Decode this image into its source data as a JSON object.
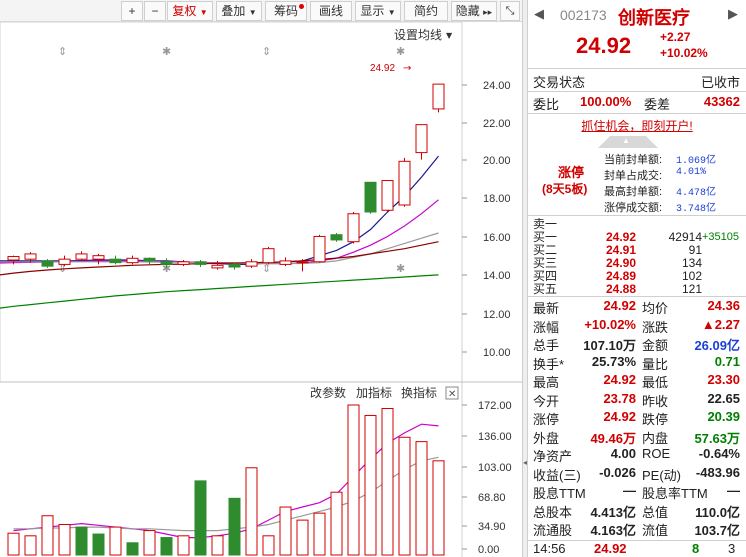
{
  "toolbar": {
    "plus": "+",
    "minus": "−",
    "fuquan": "复权",
    "diejia": "叠加",
    "chouma": "筹码",
    "huaxian": "画线",
    "xianshi": "显示",
    "jianyue": "简约",
    "yincang": "隐藏"
  },
  "chart": {
    "settings_label": "设置均线",
    "last_price_marker": "24.92",
    "price_ticks": [
      "24.00",
      "22.00",
      "20.00",
      "18.00",
      "16.00",
      "14.00",
      "12.00",
      "10.00"
    ],
    "indicator_buttons": {
      "change_params": "改参数",
      "add_indicator": "加指标",
      "switch_indicator": "换指标"
    },
    "volume_ticks": [
      "172.00",
      "136.00",
      "103.00",
      "68.80",
      "34.90",
      "0.00"
    ]
  },
  "chart_data": {
    "type": "candlestick",
    "y_range": [
      9.3,
      26.3
    ],
    "candles": [
      {
        "open": 14.85,
        "close": 15.05,
        "high": 15.1,
        "low": 14.6
      },
      {
        "open": 14.9,
        "close": 15.2,
        "high": 15.3,
        "low": 14.7
      },
      {
        "open": 14.8,
        "close": 14.5,
        "high": 14.9,
        "low": 14.4
      },
      {
        "open": 14.6,
        "close": 14.9,
        "high": 15.1,
        "low": 14.5
      },
      {
        "open": 14.9,
        "close": 15.2,
        "high": 15.35,
        "low": 14.8
      },
      {
        "open": 14.9,
        "close": 15.1,
        "high": 15.2,
        "low": 14.6
      },
      {
        "open": 14.9,
        "close": 14.7,
        "high": 15.1,
        "low": 14.6
      },
      {
        "open": 14.7,
        "close": 14.95,
        "high": 15.1,
        "low": 14.6
      },
      {
        "open": 14.95,
        "close": 14.8,
        "high": 15.0,
        "low": 14.6
      },
      {
        "open": 14.75,
        "close": 14.6,
        "high": 14.95,
        "low": 14.4
      },
      {
        "open": 14.6,
        "close": 14.75,
        "high": 14.85,
        "low": 14.5
      },
      {
        "open": 14.75,
        "close": 14.6,
        "high": 14.85,
        "low": 14.45
      },
      {
        "open": 14.4,
        "close": 14.55,
        "high": 14.8,
        "low": 14.3
      },
      {
        "open": 14.6,
        "close": 14.45,
        "high": 14.7,
        "low": 14.3
      },
      {
        "open": 14.5,
        "close": 14.75,
        "high": 14.9,
        "low": 14.4
      },
      {
        "open": 14.7,
        "close": 15.5,
        "high": 15.6,
        "low": 14.6
      },
      {
        "open": 14.6,
        "close": 14.8,
        "high": 15.0,
        "low": 14.5
      },
      {
        "open": 14.7,
        "close": 14.75,
        "high": 14.9,
        "low": 14.2
      },
      {
        "open": 14.75,
        "close": 16.2,
        "high": 16.3,
        "low": 14.7
      },
      {
        "open": 16.3,
        "close": 16.0,
        "high": 16.4,
        "low": 15.9
      },
      {
        "open": 15.9,
        "close": 17.5,
        "high": 17.6,
        "low": 15.8
      },
      {
        "open": 19.3,
        "close": 17.6,
        "high": 19.3,
        "low": 17.5
      },
      {
        "open": 17.7,
        "close": 19.4,
        "high": 19.4,
        "low": 17.6
      },
      {
        "open": 18.0,
        "close": 20.5,
        "high": 20.7,
        "low": 17.9
      },
      {
        "open": 21.0,
        "close": 22.6,
        "high": 22.6,
        "low": 20.6
      },
      {
        "open": 23.5,
        "close": 24.92,
        "high": 24.92,
        "low": 23.3
      }
    ],
    "volumes": [
      {
        "value": 25,
        "color": "red"
      },
      {
        "value": 22,
        "color": "red"
      },
      {
        "value": 45,
        "color": "red"
      },
      {
        "value": 35,
        "color": "red"
      },
      {
        "value": 32,
        "color": "green"
      },
      {
        "value": 24,
        "color": "green"
      },
      {
        "value": 32,
        "color": "red"
      },
      {
        "value": 14,
        "color": "green"
      },
      {
        "value": 28,
        "color": "red"
      },
      {
        "value": 20,
        "color": "green"
      },
      {
        "value": 22,
        "color": "red"
      },
      {
        "value": 85,
        "color": "green"
      },
      {
        "value": 22,
        "color": "red"
      },
      {
        "value": 65,
        "color": "green"
      },
      {
        "value": 100,
        "color": "red"
      },
      {
        "value": 22,
        "color": "red"
      },
      {
        "value": 55,
        "color": "red"
      },
      {
        "value": 40,
        "color": "red"
      },
      {
        "value": 48,
        "color": "red"
      },
      {
        "value": 72,
        "color": "red"
      },
      {
        "value": 172,
        "color": "red"
      },
      {
        "value": 160,
        "color": "red"
      },
      {
        "value": 168,
        "color": "red"
      },
      {
        "value": 135,
        "color": "red"
      },
      {
        "value": 130,
        "color": "red"
      },
      {
        "value": 108,
        "color": "red"
      }
    ],
    "ma_lines": [
      {
        "color": "#1a1a8c",
        "values": [
          14.8,
          14.8,
          14.8,
          14.8,
          14.82,
          14.85,
          14.85,
          14.85,
          14.8,
          14.8,
          14.75,
          14.7,
          14.65,
          14.6,
          14.6,
          14.7,
          14.75,
          14.8,
          15.1,
          15.4,
          15.9,
          16.6,
          17.6,
          18.5,
          19.6,
          20.8
        ]
      },
      {
        "color": "#cc00cc",
        "values": [
          14.7,
          14.72,
          14.74,
          14.76,
          14.78,
          14.8,
          14.8,
          14.8,
          14.78,
          14.76,
          14.74,
          14.72,
          14.7,
          14.68,
          14.66,
          14.65,
          14.65,
          14.68,
          14.8,
          14.95,
          15.3,
          15.7,
          16.2,
          16.8,
          17.5,
          18.3
        ]
      },
      {
        "color": "#999999",
        "values": [
          14.75,
          14.75,
          14.75,
          14.75,
          14.75,
          14.75,
          14.75,
          14.75,
          14.74,
          14.73,
          14.72,
          14.7,
          14.68,
          14.66,
          14.65,
          14.64,
          14.64,
          14.66,
          14.7,
          14.8,
          15.0,
          15.2,
          15.5,
          15.8,
          16.1,
          16.4
        ]
      },
      {
        "color": "#8b0000",
        "values": [
          14.1,
          14.2,
          14.28,
          14.35,
          14.4,
          14.45,
          14.5,
          14.55,
          14.58,
          14.6,
          14.62,
          14.64,
          14.66,
          14.68,
          14.7,
          14.72,
          14.75,
          14.8,
          14.88,
          14.96,
          15.05,
          15.2,
          15.35,
          15.5,
          15.7,
          15.9
        ]
      },
      {
        "color": "#008000",
        "values": [
          12.2,
          12.3,
          12.4,
          12.5,
          12.6,
          12.7,
          12.8,
          12.88,
          12.96,
          13.04,
          13.1,
          13.16,
          13.22,
          13.28,
          13.34,
          13.4,
          13.46,
          13.52,
          13.58,
          13.64,
          13.7,
          13.76,
          13.82,
          13.88,
          13.94,
          14.0
        ]
      }
    ],
    "vol_ma_lines": [
      {
        "color": "#cc00cc",
        "values": [
          28,
          30,
          32,
          34,
          36,
          34,
          32,
          30,
          28,
          24,
          20,
          20,
          22,
          25,
          30,
          40,
          50,
          55,
          60,
          70,
          90,
          110,
          128,
          140,
          150,
          148
        ]
      },
      {
        "color": "#999999",
        "values": [
          30,
          30,
          31,
          31,
          32,
          32,
          31,
          30,
          30,
          29,
          28,
          28,
          28,
          30,
          32,
          35,
          40,
          45,
          50,
          55,
          62,
          72,
          85,
          98,
          108,
          112
        ]
      }
    ]
  },
  "quote": {
    "code": "002173",
    "name": "创新医疗",
    "price": "24.92",
    "change": "+2.27",
    "change_pct": "+10.02%",
    "trade_status_label": "交易状态",
    "trade_status_value": "已收市",
    "weibi_label": "委比",
    "weibi_value": "100.00%",
    "weicha_label": "委差",
    "weicha_value": "43362",
    "promo_text": "抓住机会，即刻开户!",
    "limit_up_title": "涨停",
    "limit_up_sub": "(8天5板)",
    "seal_rows": [
      {
        "label": "当前封单额:",
        "value": "1.069亿"
      },
      {
        "label": "封单占成交:",
        "value": "4.01%"
      },
      {
        "label": "最高封单额:",
        "value": "4.478亿"
      },
      {
        "label": "涨停成交额:",
        "value": "3.748亿"
      }
    ],
    "orders": [
      {
        "label": "卖一",
        "price": "",
        "vol": ""
      },
      {
        "label": "买一",
        "price": "24.92",
        "vol": "42914",
        "extra": "+35105"
      },
      {
        "label": "买二",
        "price": "24.91",
        "vol": "91",
        "extra": ""
      },
      {
        "label": "买三",
        "price": "24.90",
        "vol": "134",
        "extra": ""
      },
      {
        "label": "买四",
        "price": "24.89",
        "vol": "102",
        "extra": ""
      },
      {
        "label": "买五",
        "price": "24.88",
        "vol": "121",
        "extra": ""
      }
    ],
    "stats": [
      {
        "l1": "最新",
        "v1": "24.92",
        "c1": "red",
        "l2": "均价",
        "v2": "24.36",
        "c2": "red"
      },
      {
        "l1": "涨幅",
        "v1": "+10.02%",
        "c1": "red",
        "l2": "涨跌",
        "v2": "▲2.27",
        "c2": "red"
      },
      {
        "l1": "总手",
        "v1": "107.10万",
        "c1": "black",
        "l2": "金额",
        "v2": "26.09亿",
        "c2": "blue"
      },
      {
        "l1": "换手*",
        "v1": "25.73%",
        "c1": "black",
        "l2": "量比",
        "v2": "0.71",
        "c2": "green"
      },
      {
        "l1": "最高",
        "v1": "24.92",
        "c1": "red",
        "l2": "最低",
        "v2": "23.30",
        "c2": "red"
      },
      {
        "l1": "今开",
        "v1": "23.78",
        "c1": "red",
        "l2": "昨收",
        "v2": "22.65",
        "c2": "black"
      },
      {
        "l1": "涨停",
        "v1": "24.92",
        "c1": "red",
        "l2": "跌停",
        "v2": "20.39",
        "c2": "green"
      },
      {
        "l1": "外盘",
        "v1": "49.46万",
        "c1": "red",
        "l2": "内盘",
        "v2": "57.63万",
        "c2": "green"
      },
      {
        "l1": "净资产",
        "v1": "4.00",
        "c1": "black",
        "l2": "ROE",
        "v2": "-0.64%",
        "c2": "black"
      },
      {
        "l1": "收益(三)",
        "v1": "-0.026",
        "c1": "black",
        "l2": "PE(动)",
        "v2": "-483.96",
        "c2": "black"
      },
      {
        "l1": "股息TTM",
        "v1": "—",
        "c1": "black",
        "l2": "股息率TTM",
        "v2": "—",
        "c2": "black"
      },
      {
        "l1": "总股本",
        "v1": "4.413亿",
        "c1": "black",
        "l2": "总值",
        "v2": "110.0亿",
        "c2": "black"
      },
      {
        "l1": "流通股",
        "v1": "4.163亿",
        "c1": "black",
        "l2": "流值",
        "v2": "103.7亿",
        "c2": "black"
      }
    ],
    "tick": {
      "time": "14:56",
      "price": "24.92",
      "vol": "8",
      "count": "3"
    }
  }
}
